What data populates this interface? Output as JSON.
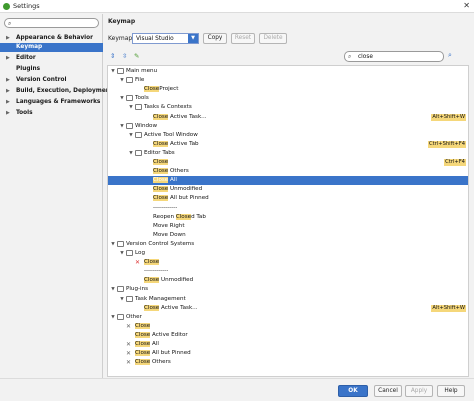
{
  "window": {
    "title": "Settings",
    "close_glyph": "✕"
  },
  "sidebar": {
    "search_placeholder": "",
    "items": [
      {
        "label": "Appearance & Behavior",
        "arrow": "▶"
      },
      {
        "label": "Keymap",
        "arrow": ""
      },
      {
        "label": "Editor",
        "arrow": "▶"
      },
      {
        "label": "Plugins",
        "arrow": ""
      },
      {
        "label": "Version Control",
        "arrow": "▶"
      },
      {
        "label": "Build, Execution, Deployment",
        "arrow": "▶"
      },
      {
        "label": "Languages & Frameworks",
        "arrow": "▶"
      },
      {
        "label": "Tools",
        "arrow": "▶"
      }
    ]
  },
  "main": {
    "title": "Keymap",
    "keymaps_label": "Keymaps:",
    "keymap_value": "Visual Studio",
    "copy_label": "Copy",
    "reset_label": "Reset",
    "delete_label": "Delete",
    "filter_value": "close",
    "filter_prefix": "⌕"
  },
  "tree": [
    {
      "t": "",
      "m": "",
      "s": "",
      "twist": "▼",
      "icon": "folder",
      "pre": "Main menu"
    },
    {
      "t": "",
      "m": "",
      "s": "",
      "twist": "▼",
      "icon": "folder",
      "pre": "File"
    },
    {
      "t": "Project",
      "m": "Close",
      "s": "",
      "twist": "",
      "icon": "",
      "pre": ""
    },
    {
      "t": "",
      "m": "",
      "s": "",
      "twist": "▼",
      "icon": "folder",
      "pre": "Tools"
    },
    {
      "t": "",
      "m": "",
      "s": "",
      "twist": "▼",
      "icon": "folder",
      "pre": "Tasks & Contexts"
    },
    {
      "t": " Active Task...",
      "m": "Close",
      "s": "Alt+Shift+W",
      "twist": "",
      "icon": "",
      "pre": ""
    },
    {
      "t": "",
      "m": "",
      "s": "",
      "twist": "▼",
      "icon": "folder",
      "pre": "Window"
    },
    {
      "t": "",
      "m": "",
      "s": "",
      "twist": "▼",
      "icon": "folder",
      "pre": "Active Tool Window"
    },
    {
      "t": " Active Tab",
      "m": "Close",
      "s": "Ctrl+Shift+F4",
      "twist": "",
      "icon": "",
      "pre": ""
    },
    {
      "t": "",
      "m": "",
      "s": "",
      "twist": "▼",
      "icon": "folder",
      "pre": "Editor Tabs"
    },
    {
      "t": "",
      "m": "Close",
      "s": "Ctrl+F4",
      "twist": "",
      "icon": "",
      "pre": ""
    },
    {
      "t": " Others",
      "m": "Close",
      "s": "",
      "twist": "",
      "icon": "",
      "pre": ""
    },
    {
      "t": " All",
      "m": "Close",
      "s": "",
      "twist": "",
      "icon": "",
      "pre": ""
    },
    {
      "t": " Unmodified",
      "m": "Close",
      "s": "",
      "twist": "",
      "icon": "",
      "pre": ""
    },
    {
      "t": " All but Pinned",
      "m": "Close",
      "s": "",
      "twist": "",
      "icon": "",
      "pre": ""
    },
    {
      "t": "",
      "m": "",
      "s": "",
      "twist": "",
      "icon": "",
      "pre": "------------"
    },
    {
      "t": "d Tab",
      "m": "Close",
      "s": "",
      "twist": "",
      "icon": "",
      "pre": "Reopen "
    },
    {
      "t": "",
      "m": "",
      "s": "",
      "twist": "",
      "icon": "",
      "pre": "Move Right"
    },
    {
      "t": "",
      "m": "",
      "s": "",
      "twist": "",
      "icon": "",
      "pre": "Move Down"
    },
    {
      "t": "",
      "m": "",
      "s": "",
      "twist": "▼",
      "icon": "folder",
      "pre": "Version Control Systems"
    },
    {
      "t": "",
      "m": "",
      "s": "",
      "twist": "▼",
      "icon": "folder",
      "pre": "Log"
    },
    {
      "t": "",
      "m": "Close",
      "s": "",
      "twist": "",
      "icon": "xred",
      "pre": ""
    },
    {
      "t": "",
      "m": "",
      "s": "",
      "twist": "",
      "icon": "",
      "pre": "------------"
    },
    {
      "t": " Unmodified",
      "m": "Close",
      "s": "",
      "twist": "",
      "icon": "",
      "pre": ""
    },
    {
      "t": "",
      "m": "",
      "s": "",
      "twist": "▼",
      "icon": "folder",
      "pre": "Plug-ins"
    },
    {
      "t": "",
      "m": "",
      "s": "",
      "twist": "▼",
      "icon": "folder",
      "pre": "Task Management"
    },
    {
      "t": " Active Task...",
      "m": "Close",
      "s": "Alt+Shift+W",
      "twist": "",
      "icon": "",
      "pre": ""
    },
    {
      "t": "",
      "m": "",
      "s": "",
      "twist": "▼",
      "icon": "folder",
      "pre": "Other"
    },
    {
      "t": "",
      "m": "Close",
      "s": "",
      "twist": "",
      "icon": "x",
      "pre": ""
    },
    {
      "t": " Active Editor",
      "m": "Close",
      "s": "",
      "twist": "",
      "icon": "",
      "pre": ""
    },
    {
      "t": " All",
      "m": "Close",
      "s": "",
      "twist": "",
      "icon": "x",
      "pre": ""
    },
    {
      "t": " All but Pinned",
      "m": "Close",
      "s": "",
      "twist": "",
      "icon": "x",
      "pre": ""
    },
    {
      "t": " Others",
      "m": "Close",
      "s": "",
      "twist": "",
      "icon": "x",
      "pre": ""
    }
  ],
  "footer": {
    "ok": "OK",
    "cancel": "Cancel",
    "apply": "Apply",
    "help": "Help"
  },
  "colors": {
    "accent": "#3a74c9",
    "highlight": "#f5d77a"
  }
}
